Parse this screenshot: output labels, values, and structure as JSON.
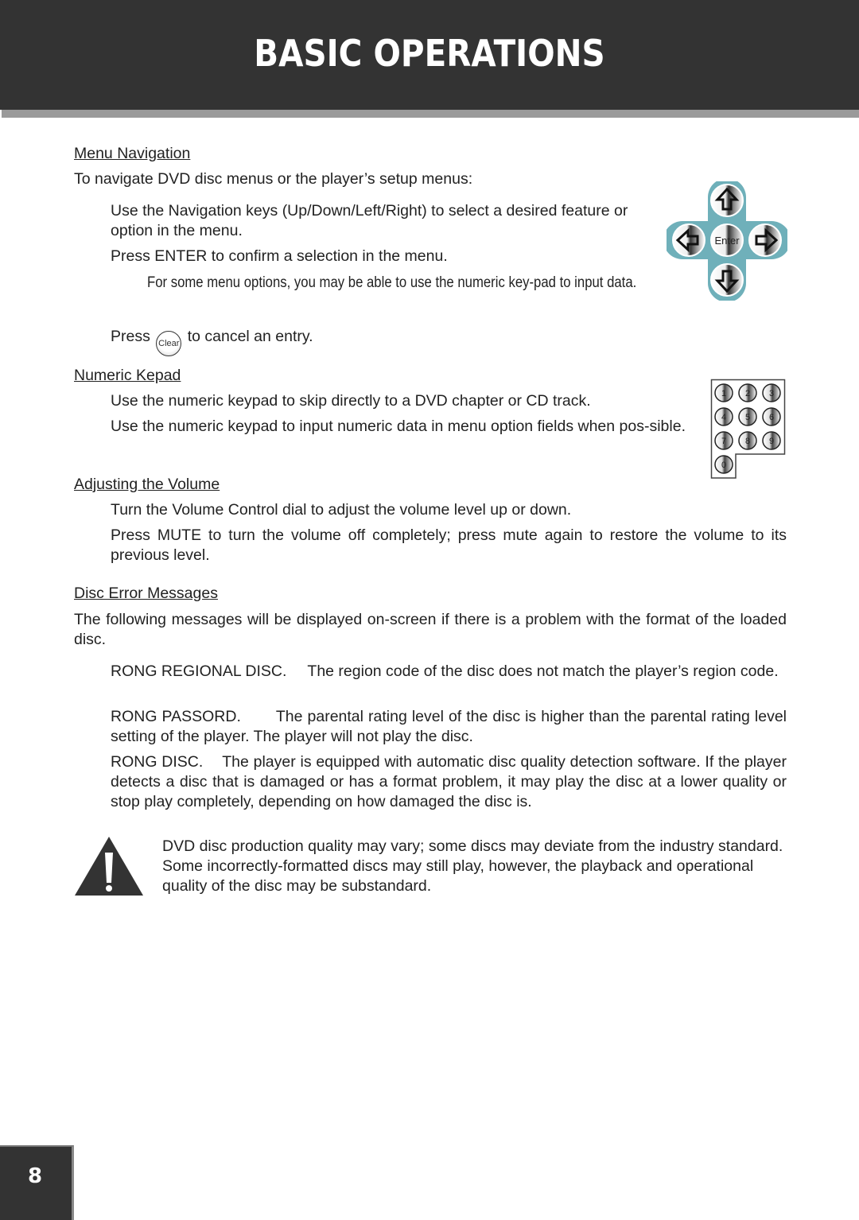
{
  "header": {
    "title": "BASIC OPERATIONS"
  },
  "sections": {
    "menu_navigation": {
      "heading": "Menu Navigation",
      "intro": "To navigate DVD disc menus or the player’s setup menus:",
      "items": [
        "Use the Navigation keys (Up/Down/Left/Right) to select a desired feature or option in the menu.",
        "Press ENTER to confirm a selection in the menu."
      ],
      "note": "For some menu options, you may be able to use the numeric key-pad to input data.",
      "clear_prefix": "Press",
      "clear_button": "Clear",
      "clear_suffix": "to cancel an entry.",
      "nav_pad": {
        "center_label": "Enter",
        "accent_color": "#6fb0ba"
      }
    },
    "numeric_keypad": {
      "heading": "Numeric Kepad",
      "items": [
        "Use the numeric keypad to skip directly to a DVD chapter or CD track.",
        "Use the numeric keypad to input numeric data in menu option fields when pos-sible."
      ],
      "keys": [
        "1",
        "2",
        "3",
        "4",
        "5",
        "6",
        "7",
        "8",
        "9",
        "0"
      ]
    },
    "volume": {
      "heading": "Adjusting the Volume",
      "items": [
        "Turn the Volume Control dial to adjust the volume level up or down.",
        "Press MUTE to turn the volume off completely; press mute again to restore the volume to its previous level."
      ]
    },
    "disc_errors": {
      "heading": "Disc Error Messages",
      "intro": "The following messages will be displayed on-screen if there is a problem with the format of the loaded disc.",
      "messages": [
        {
          "code": "RONG REGIONAL DISC.",
          "text": "The region code of the disc does not match the player’s region code."
        },
        {
          "code": "RONG PASSORD.",
          "text": "The parental rating level of the disc is higher than the parental rating level setting of the player. The player will not play the disc."
        },
        {
          "code": "RONG DISC.",
          "text": "The player is equipped with automatic disc quality detection software. If the player detects a disc that is damaged or has a format problem, it may play the disc at a lower quality or stop play completely, depending on how damaged the disc is."
        }
      ]
    },
    "warning": {
      "icon": "warning-triangle",
      "text": "DVD disc production quality may vary; some discs may deviate from the industry standard. Some incorrectly-formatted discs may still play, however, the playback and operational quality of the disc may be substandard."
    }
  },
  "footer": {
    "page_number": "8"
  }
}
